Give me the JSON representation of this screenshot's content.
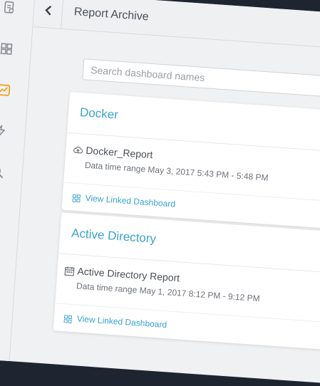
{
  "header": {
    "title": "Report Archive"
  },
  "search": {
    "placeholder": "Search dashboard names"
  },
  "cards": [
    {
      "title": "Docker",
      "report_name": "Docker_Report",
      "range": "Data time range May 3, 2017 5:43 PM - 5:48 PM",
      "report_icon": "cloud-icon",
      "link": "View Linked Dashboard"
    },
    {
      "title": "Active Directory",
      "report_name": "Active Directory Report",
      "range": "Data time range May 1, 2017 8:12 PM - 9:12 PM",
      "report_icon": "calendar-icon",
      "link": "View Linked Dashboard"
    }
  ],
  "colors": {
    "accent": "#3aa3cf",
    "active_icon": "#f0a11d",
    "dark_bar": "#1e2530"
  },
  "sidebar": {
    "icons": [
      "report-icon",
      "grid-icon",
      "chart-icon",
      "bolt-icon",
      "search-icon"
    ],
    "active": "chart-icon"
  }
}
